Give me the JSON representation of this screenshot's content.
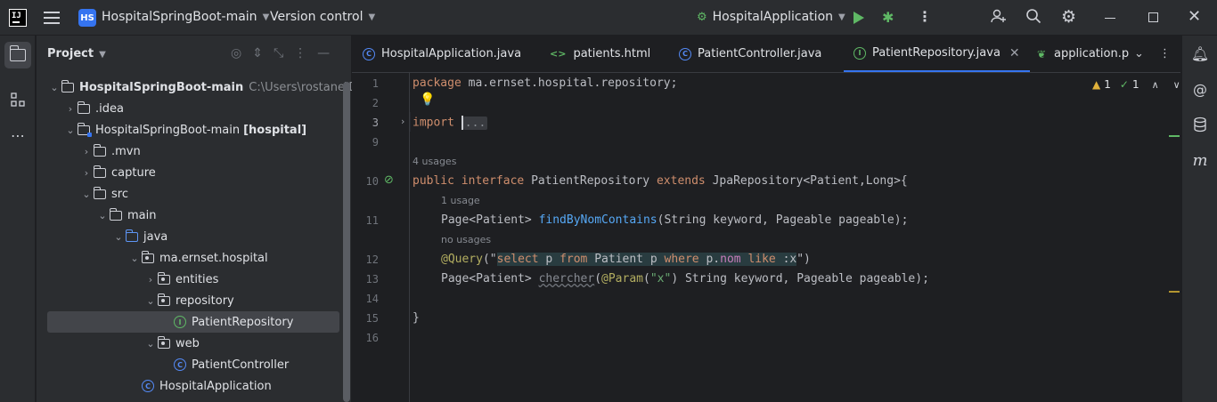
{
  "titlebar": {
    "app_logo": "IJ",
    "project_badge": "HS",
    "project_name": "HospitalSpringBoot-main",
    "vcs_label": "Version control",
    "run_config": "HospitalApplication"
  },
  "project_panel": {
    "title": "Project",
    "tree": [
      {
        "label": "HospitalSpringBoot-main",
        "path": "C:\\Users\\rostane\\Desk",
        "bold": true,
        "arrow": "down",
        "icon": "folder"
      },
      {
        "label": ".idea",
        "arrow": "right",
        "icon": "folder"
      },
      {
        "label": "HospitalSpringBoot-main",
        "suffix": "[hospital]",
        "arrow": "down",
        "icon": "module"
      },
      {
        "label": ".mvn",
        "arrow": "right",
        "icon": "folder"
      },
      {
        "label": "capture",
        "arrow": "right",
        "icon": "folder"
      },
      {
        "label": "src",
        "arrow": "down",
        "icon": "folder"
      },
      {
        "label": "main",
        "arrow": "down",
        "icon": "folder"
      },
      {
        "label": "java",
        "arrow": "down",
        "icon": "folder-blue"
      },
      {
        "label": "ma.ernset.hospital",
        "arrow": "down",
        "icon": "package"
      },
      {
        "label": "entities",
        "arrow": "right",
        "icon": "package"
      },
      {
        "label": "repository",
        "arrow": "down",
        "icon": "package"
      },
      {
        "label": "PatientRepository",
        "arrow": "",
        "icon": "interface",
        "selected": true
      },
      {
        "label": "web",
        "arrow": "down",
        "icon": "package"
      },
      {
        "label": "PatientController",
        "arrow": "",
        "icon": "class"
      },
      {
        "label": "HospitalApplication",
        "arrow": "",
        "icon": "spring-class"
      }
    ]
  },
  "editor": {
    "tabs": [
      {
        "label": "HospitalApplication.java",
        "icon": "C"
      },
      {
        "label": "patients.html",
        "icon": "<>"
      },
      {
        "label": "PatientController.java",
        "icon": "C"
      },
      {
        "label": "PatientRepository.java",
        "icon": "I",
        "active": true
      },
      {
        "label": "application.p",
        "icon": "leaf"
      }
    ],
    "inspections": {
      "warnings": "1",
      "ok": "1"
    },
    "line_numbers": [
      "1",
      "2",
      "3",
      "9",
      "10",
      "11",
      "12",
      "13",
      "14",
      "15",
      "16"
    ],
    "hints": {
      "usages_4": "4 usages",
      "usage_1": "1 usage",
      "no_usages": "no usages"
    },
    "code": {
      "l1_kw": "package",
      "l1_rest": "ma.ernset.hospital.repository;",
      "l3_kw": "import",
      "l3_fold": "...",
      "l10_public": "public",
      "l10_interface": "interface",
      "l10_name": "PatientRepository",
      "l10_extends": "extends",
      "l10_rest": "JpaRepository<Patient,Long>{",
      "l11_type": "Page<Patient>",
      "l11_fn": "findByNomContains",
      "l11_args": "(String keyword, Pageable pageable);",
      "l12_ann": "@Query",
      "l12_open": "(\"",
      "l12_sql_select": "select",
      "l12_sql_p": "p",
      "l12_sql_from": "from",
      "l12_sql_patient": "Patient p",
      "l12_sql_where": "where",
      "l12_sql_pdot": "p.",
      "l12_sql_nom": "nom",
      "l12_sql_like": "like",
      "l12_sql_x": ":x",
      "l12_close": "\")",
      "l13_type": "Page<Patient>",
      "l13_fn": "chercher",
      "l13_ann": "@Param",
      "l13_str": "\"x\"",
      "l13_rest": "String keyword, Pageable pageable);",
      "l15": "}"
    }
  },
  "colors": {
    "accent": "#3574f0",
    "keyword": "#cf8e6d",
    "function": "#56a8f5",
    "annotation": "#b3ae60",
    "string": "#6aab73"
  }
}
